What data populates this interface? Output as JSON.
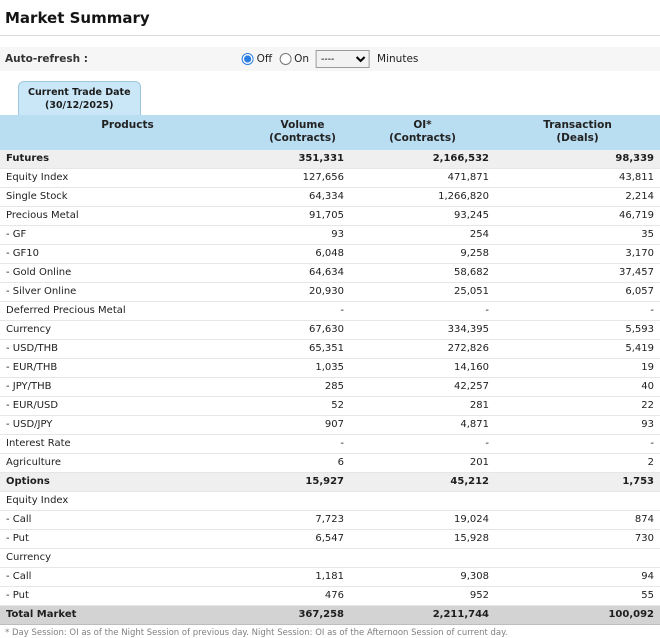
{
  "page": {
    "title": "Market Summary"
  },
  "auto_refresh": {
    "label": "Auto-refresh :",
    "off": "Off",
    "on": "On",
    "selected": "Off",
    "dropdown_value": "----",
    "minutes": "Minutes"
  },
  "tab": {
    "line1": "Current Trade Date",
    "line2": "(30/12/2025)"
  },
  "table": {
    "headers": {
      "products": {
        "title": "Products",
        "sub": ""
      },
      "volume": {
        "title": "Volume",
        "sub": "(Contracts)"
      },
      "oi": {
        "title": "OI*",
        "sub": "(Contracts)"
      },
      "transaction": {
        "title": "Transaction",
        "sub": "(Deals)"
      }
    },
    "rows": [
      {
        "product": "Futures",
        "volume": "351,331",
        "oi": "2,166,532",
        "transaction": "98,339",
        "style": "bold"
      },
      {
        "product": "Equity Index",
        "volume": "127,656",
        "oi": "471,871",
        "transaction": "43,811",
        "style": "normal"
      },
      {
        "product": "Single Stock",
        "volume": "64,334",
        "oi": "1,266,820",
        "transaction": "2,214",
        "style": "normal"
      },
      {
        "product": "Precious Metal",
        "volume": "91,705",
        "oi": "93,245",
        "transaction": "46,719",
        "style": "normal"
      },
      {
        "product": "- GF",
        "volume": "93",
        "oi": "254",
        "transaction": "35",
        "style": "normal"
      },
      {
        "product": "- GF10",
        "volume": "6,048",
        "oi": "9,258",
        "transaction": "3,170",
        "style": "normal"
      },
      {
        "product": "- Gold Online",
        "volume": "64,634",
        "oi": "58,682",
        "transaction": "37,457",
        "style": "normal"
      },
      {
        "product": "- Silver Online",
        "volume": "20,930",
        "oi": "25,051",
        "transaction": "6,057",
        "style": "normal"
      },
      {
        "product": "Deferred Precious Metal",
        "volume": "-",
        "oi": "-",
        "transaction": "-",
        "style": "normal"
      },
      {
        "product": "Currency",
        "volume": "67,630",
        "oi": "334,395",
        "transaction": "5,593",
        "style": "normal"
      },
      {
        "product": "- USD/THB",
        "volume": "65,351",
        "oi": "272,826",
        "transaction": "5,419",
        "style": "normal"
      },
      {
        "product": "- EUR/THB",
        "volume": "1,035",
        "oi": "14,160",
        "transaction": "19",
        "style": "normal"
      },
      {
        "product": "- JPY/THB",
        "volume": "285",
        "oi": "42,257",
        "transaction": "40",
        "style": "normal"
      },
      {
        "product": "- EUR/USD",
        "volume": "52",
        "oi": "281",
        "transaction": "22",
        "style": "normal"
      },
      {
        "product": "- USD/JPY",
        "volume": "907",
        "oi": "4,871",
        "transaction": "93",
        "style": "normal"
      },
      {
        "product": "Interest Rate",
        "volume": "-",
        "oi": "-",
        "transaction": "-",
        "style": "normal"
      },
      {
        "product": "Agriculture",
        "volume": "6",
        "oi": "201",
        "transaction": "2",
        "style": "normal"
      },
      {
        "product": "Options",
        "volume": "15,927",
        "oi": "45,212",
        "transaction": "1,753",
        "style": "bold"
      },
      {
        "product": "Equity Index",
        "volume": "",
        "oi": "",
        "transaction": "",
        "style": "normal"
      },
      {
        "product": "- Call",
        "volume": "7,723",
        "oi": "19,024",
        "transaction": "874",
        "style": "normal"
      },
      {
        "product": "- Put",
        "volume": "6,547",
        "oi": "15,928",
        "transaction": "730",
        "style": "normal"
      },
      {
        "product": "Currency",
        "volume": "",
        "oi": "",
        "transaction": "",
        "style": "normal"
      },
      {
        "product": "- Call",
        "volume": "1,181",
        "oi": "9,308",
        "transaction": "94",
        "style": "normal"
      },
      {
        "product": "- Put",
        "volume": "476",
        "oi": "952",
        "transaction": "55",
        "style": "normal"
      },
      {
        "product": "Total Market",
        "volume": "367,258",
        "oi": "2,211,744",
        "transaction": "100,092",
        "style": "total"
      }
    ]
  },
  "footnote": "* Day Session: OI as of the Night Session of previous day. Night Session: OI as of the Afternoon Session of current day.",
  "colors": {
    "header_bg": "#b9ddf1",
    "tab_bg": "#c9e7f7",
    "tab_border": "#9ec6dc",
    "section_row_bg": "#efefef",
    "total_row_bg": "#d3d3d3",
    "accent_blue": "#2a7de1",
    "bar_bg": "#f6f6f6"
  }
}
